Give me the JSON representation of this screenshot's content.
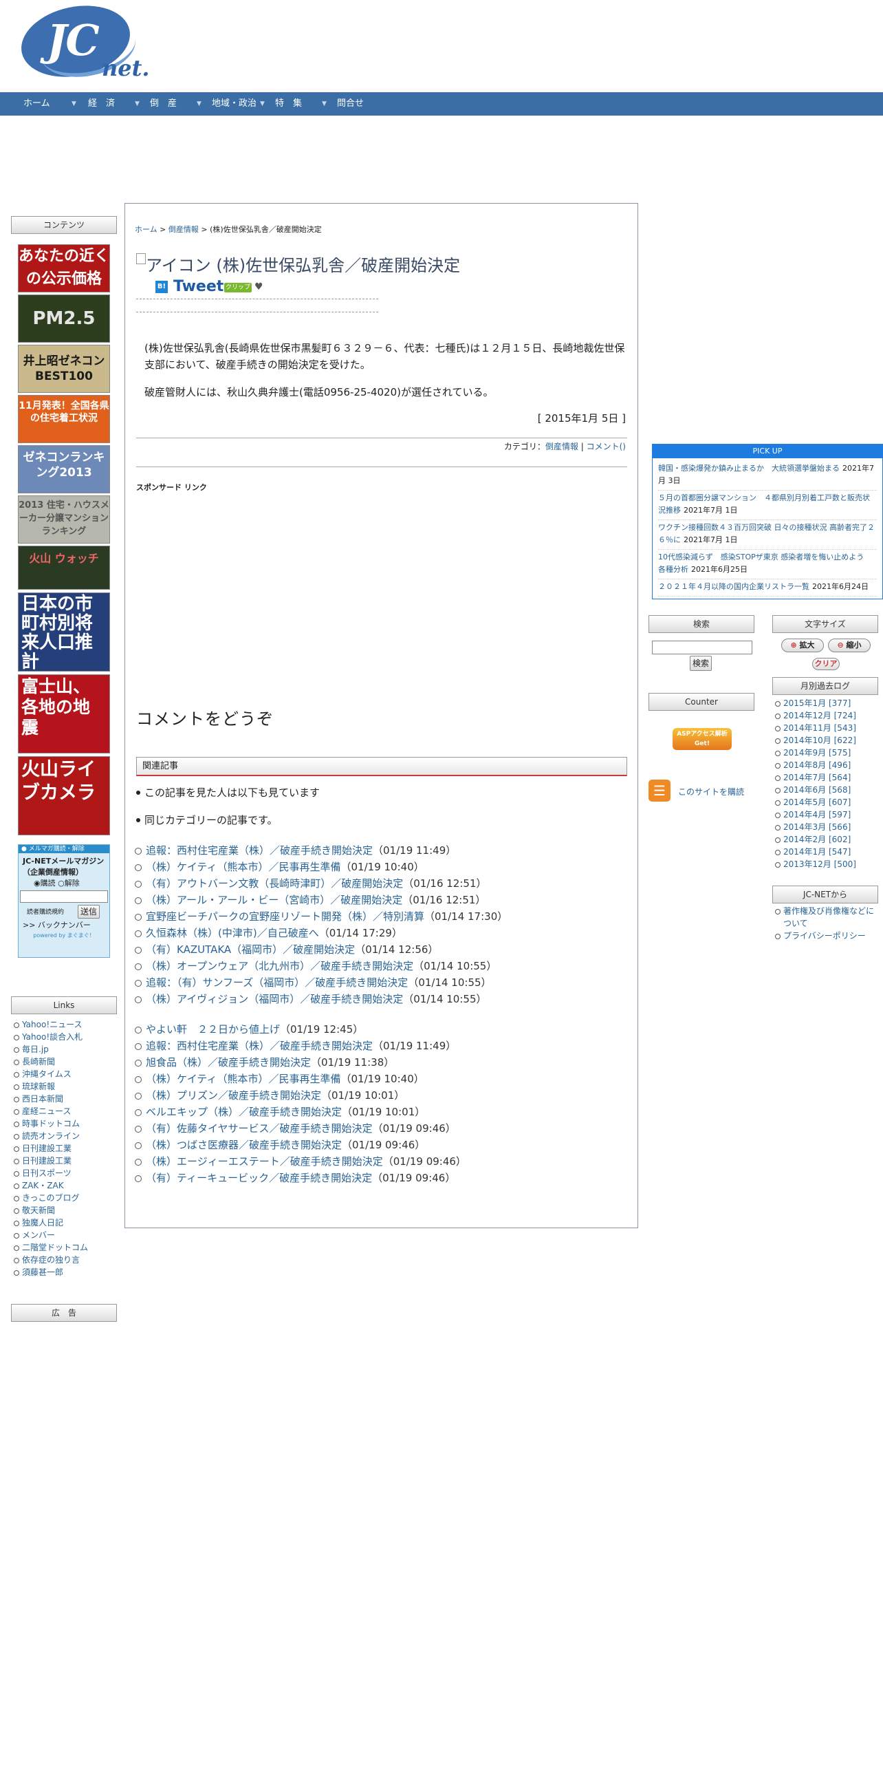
{
  "logo": {
    "jc": "JC",
    "net": "net."
  },
  "nav": [
    {
      "label": "ホーム"
    },
    {
      "label": "経　済"
    },
    {
      "label": "倒　産"
    },
    {
      "label": "地域・政治"
    },
    {
      "label": "特　集"
    },
    {
      "label": "問合せ"
    }
  ],
  "left": {
    "contents_head": "コンテンツ",
    "banners": [
      {
        "text": "あなたの近くの公示価格"
      },
      {
        "text": "PM2.5"
      },
      {
        "text": "井上昭ゼネコンBEST100"
      },
      {
        "text": "11月発表！全国各県の住宅着工状況"
      },
      {
        "text": "ゼネコンランキング2013"
      },
      {
        "text": "2013 住宅・ハウスメーカー分譲マンションランキング"
      },
      {
        "text": "火山 ウォッチ"
      },
      {
        "text": "日本の市町村別将来人口推計"
      },
      {
        "text": "富士山、各地の地震"
      },
      {
        "text": "火山ライブカメラ"
      }
    ],
    "mail": {
      "head": "● メルマガ購読・解除",
      "title": "JC-NETメールマガジン（企業倒産情報）",
      "subscribe": "購読",
      "unsubscribe": "解除",
      "terms": "読者購読規約",
      "send": "送信",
      "backnumber": ">> バックナンバー",
      "powered": "powered by まぐまぐ！"
    },
    "links_head": "Links",
    "links": [
      "Yahoo!ニュース",
      "Yahoo!談合入札",
      "毎日.jp",
      "長崎新聞",
      "沖縄タイムス",
      "琉球新報",
      "西日本新聞",
      "産経ニュース",
      "時事ドットコム",
      "読売オンライン",
      "日刊建設工業",
      "日刊建設工業",
      "日刊スポーツ",
      "ZAK・ZAK",
      "きっこのブログ",
      "敬天新聞",
      "独魔人日記",
      "メンバー",
      "二階堂ドットコム",
      "依存症の独り言",
      "須藤甚一郎"
    ],
    "ad_head": "広　告"
  },
  "main": {
    "breadcrumb": [
      "ホーム",
      "倒産情報",
      "(株)佐世保弘乳舎／破産開始決定"
    ],
    "breadcrumb_sep": ">",
    "title": "アイコン (株)佐世保弘乳舎／破産開始決定",
    "tweet": "Tweet",
    "clip": "クリップ",
    "body1": "(株)佐世保弘乳舎(長崎県佐世保市黒髪町６３２９－６、代表：七種氏)は１２月１５日、長崎地裁佐世保支部において、破産手続きの開始決定を受けた。",
    "body2": "破産管財人には、秋山久典弁護士(電話0956-25-4020)が選任されている。",
    "date": "[ 2015年1月 5日 ]",
    "category_label": "カテゴリ：",
    "category": "倒産情報",
    "comment_link": "コメント()",
    "sponsored": "スポンサード リンク",
    "comment_heading": "コメントをどうぞ",
    "related_head": "関連記事",
    "related_sub1": "この記事を見た人は以下も見ています",
    "related_sub2": "同じカテゴリーの記事です。",
    "list1": [
      {
        "t": "追報：西村住宅産業（株）／破産手続き開始決定",
        "d": "（01/19 11:49）"
      },
      {
        "t": "（株）ケイティ（熊本市）／民事再生準備",
        "d": "（01/19 10:40）"
      },
      {
        "t": "（有）アウトバーン文教（長崎時津町）／破産開始決定",
        "d": "（01/16 12:51）"
      },
      {
        "t": "（株）アール・アール・ビー（宮崎市）／破産開始決定",
        "d": "（01/16 12:51）"
      },
      {
        "t": "宜野座ビーチパークの宜野座リゾート開発（株）／特別清算",
        "d": "（01/14 17:30）"
      },
      {
        "t": "久恒森林（株）(中津市)／自己破産へ",
        "d": "（01/14 17:29）"
      },
      {
        "t": "（有）KAZUTAKA（福岡市）／破産開始決定",
        "d": "（01/14 12:56）"
      },
      {
        "t": "（株）オープンウェア（北九州市）／破産手続き開始決定",
        "d": "（01/14 10:55）"
      },
      {
        "t": "追報：（有）サンフーズ（福岡市）／破産手続き開始決定",
        "d": "（01/14 10:55）"
      },
      {
        "t": "（株）アイヴィジョン（福岡市）／破産手続き開始決定",
        "d": "（01/14 10:55）"
      }
    ],
    "list2": [
      {
        "t": "やよい軒　２２日から値上げ",
        "d": "（01/19 12:45）"
      },
      {
        "t": "追報：西村住宅産業（株）／破産手続き開始決定",
        "d": "（01/19 11:49）"
      },
      {
        "t": "旭食品（株）／破産手続き開始決定",
        "d": "（01/19 11:38）"
      },
      {
        "t": "（株）ケイティ（熊本市）／民事再生準備",
        "d": "（01/19 10:40）"
      },
      {
        "t": "（株）プリズン／破産手続き開始決定",
        "d": "（01/19 10:01）"
      },
      {
        "t": "ベルエキップ（株）／破産手続き開始決定",
        "d": "（01/19 10:01）"
      },
      {
        "t": "（有）佐藤タイヤサービス／破産手続き開始決定",
        "d": "（01/19 09:46）"
      },
      {
        "t": "（株）つばさ医療器／破産手続き開始決定",
        "d": "（01/19 09:46）"
      },
      {
        "t": "（株）エージィーエステート／破産手続き開始決定",
        "d": "（01/19 09:46）"
      },
      {
        "t": "（有）ティーキュービック／破産手続き開始決定",
        "d": "（01/19 09:46）"
      }
    ]
  },
  "right": {
    "pickup_head": "PICK UP",
    "pickup": [
      {
        "t": "韓国・感染爆発か鎮み止まるか　大統領選挙盤始まる",
        "d": "2021年7月 3日"
      },
      {
        "t": "５月の首都圏分譲マンション　４都県別月別着工戸数と販売状況推移",
        "d": "2021年7月 1日"
      },
      {
        "t": "ワクチン接種回数４３百万回突破 日々の接種状況 高齢者完了２６％に",
        "d": "2021年7月 1日"
      },
      {
        "t": "10代感染減らず　感染STOPザ東京 感染者増を悔い止めよう　　各種分析",
        "d": "2021年6月25日"
      },
      {
        "t": "２０２１年４月以降の国内企業リストラ一覧",
        "d": "2021年6月24日"
      }
    ],
    "search_head": "検索",
    "search_btn": "検索",
    "fontsize_head": "文字サイズ",
    "enlarge": "拡大",
    "shrink": "縮小",
    "clear": "クリア",
    "counter_head": "Counter",
    "counter_badge": "ASPアクセス解析 Get!",
    "rss_label": "このサイトを購読",
    "archive_head": "月別過去ログ",
    "archive": [
      "2015年1月 [377]",
      "2014年12月 [724]",
      "2014年11月 [543]",
      "2014年10月 [622]",
      "2014年9月 [575]",
      "2014年8月 [496]",
      "2014年7月 [564]",
      "2014年6月 [568]",
      "2014年5月 [607]",
      "2014年4月 [597]",
      "2014年3月 [566]",
      "2014年2月 [602]",
      "2014年1月 [547]",
      "2013年12月 [500]"
    ],
    "from_head": "JC-NETから",
    "from_links": [
      "著作権及び肖像権などについて",
      "プライバシーポリシー"
    ]
  }
}
